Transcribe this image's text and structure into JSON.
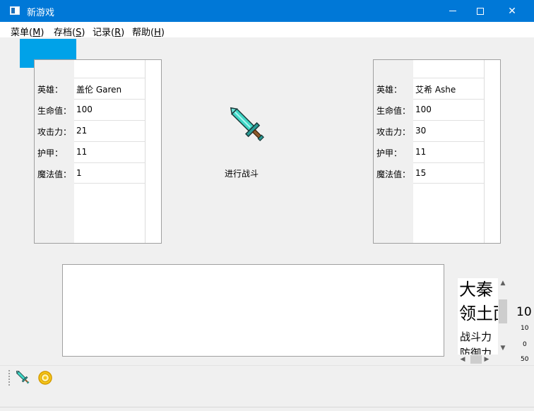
{
  "window": {
    "title": "新游戏",
    "accent_color": "#0078d7",
    "controls": {
      "minimize_icon": "minimize-icon",
      "maximize_icon": "maximize-icon",
      "close_icon": "close-icon",
      "close_glyph": "✕"
    }
  },
  "menu": {
    "items": [
      {
        "label": "菜单",
        "mnemonic": "M"
      },
      {
        "label": "存档",
        "mnemonic": "S"
      },
      {
        "label": "记录",
        "mnemonic": "R"
      },
      {
        "label": "帮助",
        "mnemonic": "H"
      }
    ]
  },
  "hero_left": {
    "rows": [
      {
        "label": "英雄：",
        "value": "盖伦 Garen"
      },
      {
        "label": "生命值：",
        "value": "100"
      },
      {
        "label": "攻击力：",
        "value": "21"
      },
      {
        "label": "护甲：",
        "value": "11"
      },
      {
        "label": "魔法值：",
        "value": "1"
      }
    ]
  },
  "hero_right": {
    "rows": [
      {
        "label": "英雄：",
        "value": "艾希 Ashe"
      },
      {
        "label": "生命值：",
        "value": "100"
      },
      {
        "label": "攻击力：",
        "value": "30"
      },
      {
        "label": "护甲：",
        "value": "11"
      },
      {
        "label": "魔法值：",
        "value": "15"
      }
    ]
  },
  "battle": {
    "label": "进行战斗",
    "icon": "sword-icon"
  },
  "side_panel": {
    "line1": "大秦",
    "line2": "领土面",
    "line3": "战斗力",
    "line4": "防御力",
    "axis_label": "10",
    "ticks": [
      "10",
      "0",
      "50"
    ]
  },
  "toolbar": {
    "buttons": [
      {
        "icon": "sword-icon"
      },
      {
        "icon": "coin-icon"
      }
    ]
  },
  "colors": {
    "highlight_block": "#00a2e8"
  }
}
